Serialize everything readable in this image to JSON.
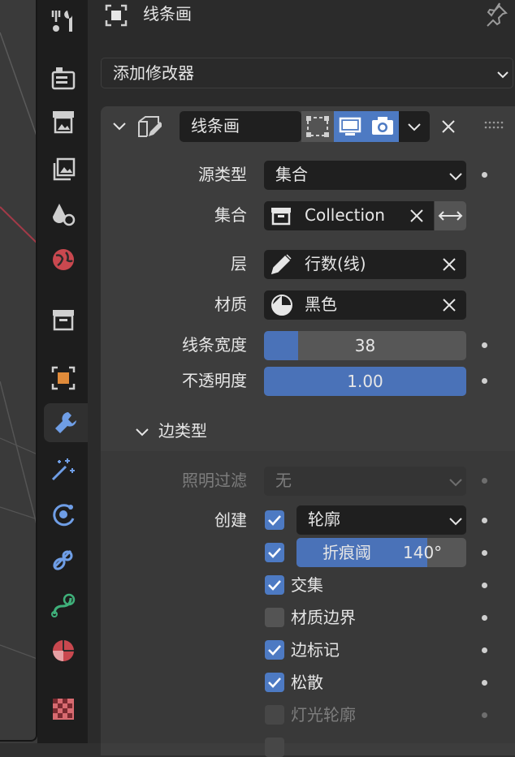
{
  "header": {
    "title": "线条画",
    "pin_icon": "pin-icon"
  },
  "add_modifier": {
    "label": "添加修改器"
  },
  "modifier": {
    "name": "线条画",
    "source_type": {
      "label": "源类型",
      "value": "集合"
    },
    "collection": {
      "label": "集合",
      "value": "Collection"
    },
    "layer": {
      "label": "层",
      "value": "行数(线)"
    },
    "material": {
      "label": "材质",
      "value": "黑色"
    },
    "line_width": {
      "label": "线条宽度",
      "value": "38",
      "fraction": 0.17
    },
    "opacity": {
      "label": "不透明度",
      "value": "1.00",
      "fraction": 1.0
    }
  },
  "edge_types": {
    "title": "边类型",
    "light_filter": {
      "label": "照明过滤",
      "value": "无"
    },
    "create": {
      "label": "创建",
      "dropdown": "轮廓"
    },
    "crease": {
      "label": "折痕阈",
      "value": "140°",
      "fraction": 0.77,
      "checked": true
    },
    "contour_checked": true,
    "items": [
      {
        "label": "交集",
        "checked": true,
        "enabled": true
      },
      {
        "label": "材质边界",
        "checked": false,
        "enabled": true
      },
      {
        "label": "边标记",
        "checked": true,
        "enabled": true
      },
      {
        "label": "松散",
        "checked": true,
        "enabled": true
      },
      {
        "label": "灯光轮廓",
        "checked": false,
        "enabled": false
      }
    ]
  },
  "colors": {
    "accent": "#4d7ac3",
    "panel": "#2b2b2b",
    "box": "#3d3d3d",
    "field": "#1f1f1f"
  },
  "tabs": [
    "tool-icon",
    "render-icon",
    "output-icon",
    "view-layer-icon",
    "scene-icon",
    "world-icon",
    "collection-icon",
    "object-icon",
    "modifier-icon",
    "particles-icon",
    "physics-icon",
    "constraints-icon",
    "data-icon",
    "material-icon",
    "texture-icon"
  ]
}
